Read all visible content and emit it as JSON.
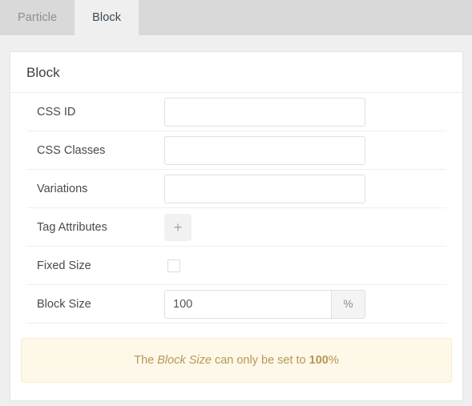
{
  "tabs": [
    {
      "label": "Particle",
      "active": false
    },
    {
      "label": "Block",
      "active": true
    }
  ],
  "panel": {
    "title": "Block",
    "rows": [
      {
        "label": "CSS ID",
        "type": "text",
        "value": "",
        "placeholder": ""
      },
      {
        "label": "CSS Classes",
        "type": "text",
        "value": "",
        "placeholder": ""
      },
      {
        "label": "Variations",
        "type": "text",
        "value": "",
        "placeholder": ""
      },
      {
        "label": "Tag Attributes",
        "type": "button",
        "button_label": "+"
      },
      {
        "label": "Fixed Size",
        "type": "checkbox",
        "checked": false
      },
      {
        "label": "Block Size",
        "type": "text-addon",
        "value": "100",
        "addon": "%"
      }
    ]
  },
  "alert": {
    "prefix": "The ",
    "emphasis": "Block Size",
    "middle": " can only be set to ",
    "strong": "100",
    "suffix": "%"
  },
  "colors": {
    "tabbar_bg": "#d9d9d9",
    "page_bg": "#efefef",
    "card_bg": "#ffffff",
    "active_tab_text": "#3d4852",
    "inactive_tab_text": "#8e8e8e",
    "alert_bg": "#fdf8e7",
    "alert_border": "#f7edd3",
    "alert_text": "#b8975a"
  }
}
